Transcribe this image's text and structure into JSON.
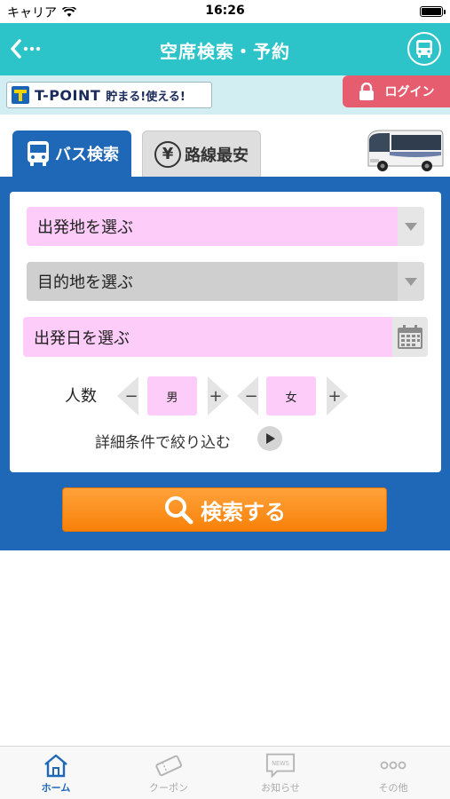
{
  "status_bar": {
    "carrier": "キャリア",
    "time": "16:26"
  },
  "nav": {
    "title": "空席検索・予約"
  },
  "promo": {
    "tpoint_text": "T-POINT",
    "tpoint_sub": "貯まる!使える!",
    "login_label": "ログイン"
  },
  "tabs": [
    {
      "label": "バス検索",
      "active": true
    },
    {
      "label": "路線最安",
      "active": false
    }
  ],
  "form": {
    "departure_placeholder": "出発地を選ぶ",
    "destination_placeholder": "目的地を選ぶ",
    "date_placeholder": "出発日を選ぶ",
    "people_label": "人数",
    "male_label": "男",
    "female_label": "女",
    "minus": "−",
    "plus": "+",
    "detail_label": "詳細条件で絞り込む"
  },
  "search_button": {
    "label": "検索する"
  },
  "bottom_tabs": [
    {
      "label": "ホーム",
      "icon": "home-icon",
      "active": true
    },
    {
      "label": "クーポン",
      "icon": "coupon-icon",
      "active": false
    },
    {
      "label": "お知らせ",
      "icon": "news-icon",
      "active": false
    },
    {
      "label": "その他",
      "icon": "more-icon",
      "active": false
    }
  ],
  "colors": {
    "nav": "#2cc4c8",
    "panel": "#1f68b8",
    "field_pink": "#fdccf8",
    "field_grey": "#cfcfcf",
    "login": "#e65d6f",
    "search": "#f7810a"
  }
}
